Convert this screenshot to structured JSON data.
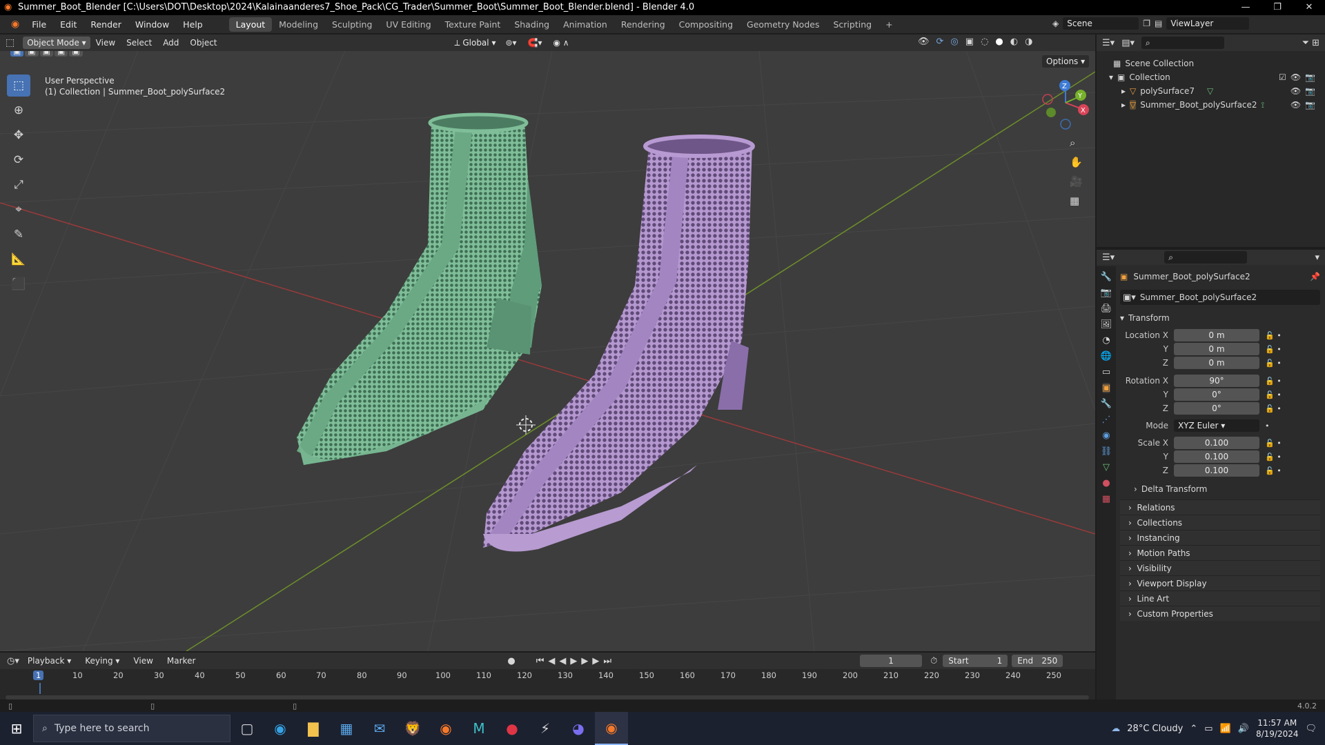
{
  "window": {
    "title": "Summer_Boot_Blender [C:\\Users\\DOT\\Desktop\\2024\\Kalainaanderes7_Shoe_Pack\\CG_Trader\\Summer_Boot\\Summer_Boot_Blender.blend] - Blender 4.0"
  },
  "menu": {
    "items": [
      "File",
      "Edit",
      "Render",
      "Window",
      "Help"
    ]
  },
  "workspaces": [
    "Layout",
    "Modeling",
    "Sculpting",
    "UV Editing",
    "Texture Paint",
    "Shading",
    "Animation",
    "Rendering",
    "Compositing",
    "Geometry Nodes",
    "Scripting"
  ],
  "active_workspace": "Layout",
  "scene": {
    "name": "Scene",
    "view_layer": "ViewLayer"
  },
  "viewport_header": {
    "mode": "Object Mode",
    "menus": [
      "View",
      "Select",
      "Add",
      "Object"
    ],
    "transform_orientation": "Global",
    "options_label": "Options"
  },
  "viewport": {
    "perspective": "User Perspective",
    "collection_info": "(1) Collection | Summer_Boot_polySurface2"
  },
  "gizmo": {
    "x": "X",
    "y": "Y",
    "z": "Z"
  },
  "outliner": {
    "root": "Scene Collection",
    "collection": "Collection",
    "items": [
      "polySurface7",
      "Summer_Boot_polySurface2"
    ]
  },
  "properties": {
    "object_name": "Summer_Boot_polySurface2",
    "data_name": "Summer_Boot_polySurface2",
    "transform_header": "Transform",
    "location": {
      "label": "Location X",
      "x": "0 m",
      "y": "0 m",
      "z": "0 m"
    },
    "rotation": {
      "label": "Rotation X",
      "x": "90°",
      "y": "0°",
      "z": "0°"
    },
    "mode": {
      "label": "Mode",
      "value": "XYZ Euler"
    },
    "scale": {
      "label": "Scale X",
      "x": "0.100",
      "y": "0.100",
      "z": "0.100"
    },
    "axis_y": "Y",
    "axis_z": "Z",
    "delta": "Delta Transform",
    "panels": [
      "Relations",
      "Collections",
      "Instancing",
      "Motion Paths",
      "Visibility",
      "Viewport Display",
      "Line Art",
      "Custom Properties"
    ]
  },
  "timeline": {
    "menus": [
      "Playback",
      "Keying",
      "View",
      "Marker"
    ],
    "current_frame": "1",
    "start_label": "Start",
    "start": "1",
    "end_label": "End",
    "end": "250",
    "ticks": [
      "1",
      "10",
      "20",
      "30",
      "40",
      "50",
      "60",
      "70",
      "80",
      "90",
      "100",
      "110",
      "120",
      "130",
      "140",
      "150",
      "160",
      "170",
      "180",
      "190",
      "200",
      "210",
      "220",
      "230",
      "240",
      "250"
    ]
  },
  "status": {
    "version": "4.0.2"
  },
  "taskbar": {
    "search_placeholder": "Type here to search",
    "weather": "28°C Cloudy",
    "time": "11:57 AM",
    "date": "8/19/2024"
  },
  "colors": {
    "green_boot": "#6fae8a",
    "purple_boot": "#a98ac4",
    "accent": "#4772b3"
  }
}
